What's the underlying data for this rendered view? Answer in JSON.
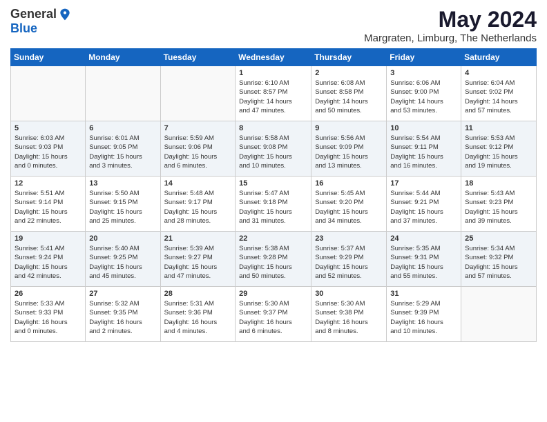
{
  "header": {
    "logo_general": "General",
    "logo_blue": "Blue",
    "month_year": "May 2024",
    "location": "Margraten, Limburg, The Netherlands"
  },
  "days_of_week": [
    "Sunday",
    "Monday",
    "Tuesday",
    "Wednesday",
    "Thursday",
    "Friday",
    "Saturday"
  ],
  "weeks": [
    [
      {
        "day": "",
        "info": ""
      },
      {
        "day": "",
        "info": ""
      },
      {
        "day": "",
        "info": ""
      },
      {
        "day": "1",
        "info": "Sunrise: 6:10 AM\nSunset: 8:57 PM\nDaylight: 14 hours\nand 47 minutes."
      },
      {
        "day": "2",
        "info": "Sunrise: 6:08 AM\nSunset: 8:58 PM\nDaylight: 14 hours\nand 50 minutes."
      },
      {
        "day": "3",
        "info": "Sunrise: 6:06 AM\nSunset: 9:00 PM\nDaylight: 14 hours\nand 53 minutes."
      },
      {
        "day": "4",
        "info": "Sunrise: 6:04 AM\nSunset: 9:02 PM\nDaylight: 14 hours\nand 57 minutes."
      }
    ],
    [
      {
        "day": "5",
        "info": "Sunrise: 6:03 AM\nSunset: 9:03 PM\nDaylight: 15 hours\nand 0 minutes."
      },
      {
        "day": "6",
        "info": "Sunrise: 6:01 AM\nSunset: 9:05 PM\nDaylight: 15 hours\nand 3 minutes."
      },
      {
        "day": "7",
        "info": "Sunrise: 5:59 AM\nSunset: 9:06 PM\nDaylight: 15 hours\nand 6 minutes."
      },
      {
        "day": "8",
        "info": "Sunrise: 5:58 AM\nSunset: 9:08 PM\nDaylight: 15 hours\nand 10 minutes."
      },
      {
        "day": "9",
        "info": "Sunrise: 5:56 AM\nSunset: 9:09 PM\nDaylight: 15 hours\nand 13 minutes."
      },
      {
        "day": "10",
        "info": "Sunrise: 5:54 AM\nSunset: 9:11 PM\nDaylight: 15 hours\nand 16 minutes."
      },
      {
        "day": "11",
        "info": "Sunrise: 5:53 AM\nSunset: 9:12 PM\nDaylight: 15 hours\nand 19 minutes."
      }
    ],
    [
      {
        "day": "12",
        "info": "Sunrise: 5:51 AM\nSunset: 9:14 PM\nDaylight: 15 hours\nand 22 minutes."
      },
      {
        "day": "13",
        "info": "Sunrise: 5:50 AM\nSunset: 9:15 PM\nDaylight: 15 hours\nand 25 minutes."
      },
      {
        "day": "14",
        "info": "Sunrise: 5:48 AM\nSunset: 9:17 PM\nDaylight: 15 hours\nand 28 minutes."
      },
      {
        "day": "15",
        "info": "Sunrise: 5:47 AM\nSunset: 9:18 PM\nDaylight: 15 hours\nand 31 minutes."
      },
      {
        "day": "16",
        "info": "Sunrise: 5:45 AM\nSunset: 9:20 PM\nDaylight: 15 hours\nand 34 minutes."
      },
      {
        "day": "17",
        "info": "Sunrise: 5:44 AM\nSunset: 9:21 PM\nDaylight: 15 hours\nand 37 minutes."
      },
      {
        "day": "18",
        "info": "Sunrise: 5:43 AM\nSunset: 9:23 PM\nDaylight: 15 hours\nand 39 minutes."
      }
    ],
    [
      {
        "day": "19",
        "info": "Sunrise: 5:41 AM\nSunset: 9:24 PM\nDaylight: 15 hours\nand 42 minutes."
      },
      {
        "day": "20",
        "info": "Sunrise: 5:40 AM\nSunset: 9:25 PM\nDaylight: 15 hours\nand 45 minutes."
      },
      {
        "day": "21",
        "info": "Sunrise: 5:39 AM\nSunset: 9:27 PM\nDaylight: 15 hours\nand 47 minutes."
      },
      {
        "day": "22",
        "info": "Sunrise: 5:38 AM\nSunset: 9:28 PM\nDaylight: 15 hours\nand 50 minutes."
      },
      {
        "day": "23",
        "info": "Sunrise: 5:37 AM\nSunset: 9:29 PM\nDaylight: 15 hours\nand 52 minutes."
      },
      {
        "day": "24",
        "info": "Sunrise: 5:35 AM\nSunset: 9:31 PM\nDaylight: 15 hours\nand 55 minutes."
      },
      {
        "day": "25",
        "info": "Sunrise: 5:34 AM\nSunset: 9:32 PM\nDaylight: 15 hours\nand 57 minutes."
      }
    ],
    [
      {
        "day": "26",
        "info": "Sunrise: 5:33 AM\nSunset: 9:33 PM\nDaylight: 16 hours\nand 0 minutes."
      },
      {
        "day": "27",
        "info": "Sunrise: 5:32 AM\nSunset: 9:35 PM\nDaylight: 16 hours\nand 2 minutes."
      },
      {
        "day": "28",
        "info": "Sunrise: 5:31 AM\nSunset: 9:36 PM\nDaylight: 16 hours\nand 4 minutes."
      },
      {
        "day": "29",
        "info": "Sunrise: 5:30 AM\nSunset: 9:37 PM\nDaylight: 16 hours\nand 6 minutes."
      },
      {
        "day": "30",
        "info": "Sunrise: 5:30 AM\nSunset: 9:38 PM\nDaylight: 16 hours\nand 8 minutes."
      },
      {
        "day": "31",
        "info": "Sunrise: 5:29 AM\nSunset: 9:39 PM\nDaylight: 16 hours\nand 10 minutes."
      },
      {
        "day": "",
        "info": ""
      }
    ]
  ]
}
